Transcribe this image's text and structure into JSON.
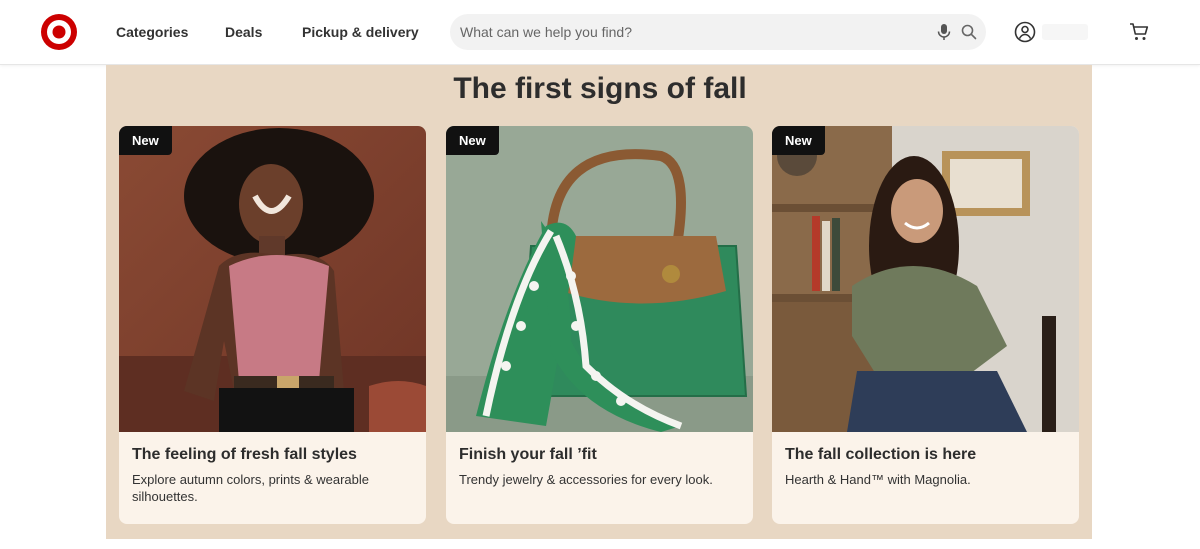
{
  "header": {
    "logo_icon": "target-bullseye-logo",
    "brand_color": "#cc0000",
    "nav": {
      "categories": "Categories",
      "deals": "Deals",
      "pickup": "Pickup & delivery"
    },
    "search": {
      "placeholder": "What can we help you find?",
      "value": ""
    },
    "icons": [
      "mic-icon",
      "search-icon",
      "account-icon",
      "cart-icon"
    ]
  },
  "main": {
    "title": "The first signs of fall",
    "background_color": "#e8d7c3",
    "cards": [
      {
        "badge": "New",
        "title": "The feeling of fresh fall styles",
        "description": "Explore autumn colors, prints & wearable silhouettes."
      },
      {
        "badge": "New",
        "title": "Finish your fall ’fit",
        "description": "Trendy jewelry & accessories for every look."
      },
      {
        "badge": "New",
        "title": "The fall collection is here",
        "description": "Hearth & Hand™ with Magnolia."
      }
    ]
  }
}
